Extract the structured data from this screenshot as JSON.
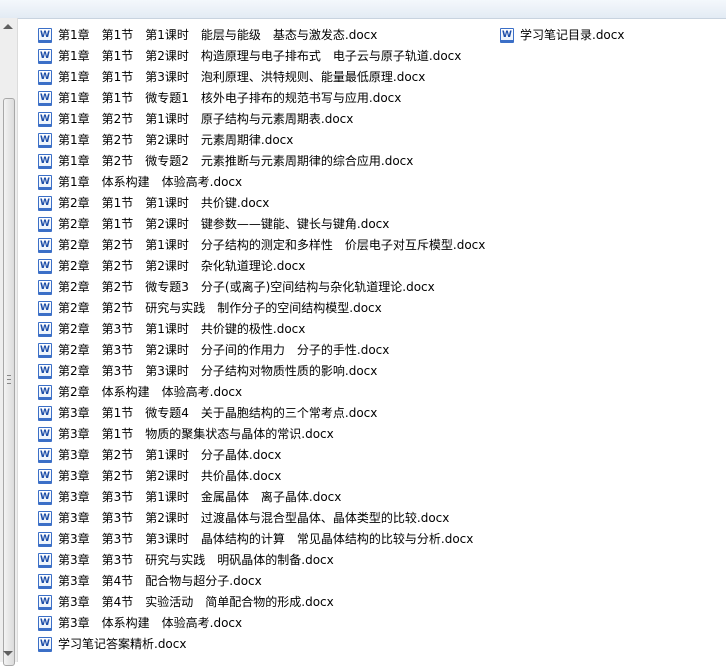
{
  "files": [
    "第1章　第1节　第1课时　能层与能级　基态与激发态.docx",
    "第1章　第1节　第2课时　构造原理与电子排布式　电子云与原子轨道.docx",
    "第1章　第1节　第3课时　泡利原理、洪特规则、能量最低原理.docx",
    "第1章　第1节　微专题1　核外电子排布的规范书写与应用.docx",
    "第1章　第2节　第1课时　原子结构与元素周期表.docx",
    "第1章　第2节　第2课时　元素周期律.docx",
    "第1章　第2节　微专题2　元素推断与元素周期律的综合应用.docx",
    "第1章　体系构建　体验高考.docx",
    "第2章　第1节　第1课时　共价键.docx",
    "第2章　第1节　第2课时　键参数——键能、键长与键角.docx",
    "第2章　第2节　第1课时　分子结构的测定和多样性　价层电子对互斥模型.docx",
    "第2章　第2节　第2课时　杂化轨道理论.docx",
    "第2章　第2节　微专题3　分子(或离子)空间结构与杂化轨道理论.docx",
    "第2章　第2节　研究与实践　制作分子的空间结构模型.docx",
    "第2章　第3节　第1课时　共价键的极性.docx",
    "第2章　第3节　第2课时　分子间的作用力　分子的手性.docx",
    "第2章　第3节　第3课时　分子结构对物质性质的影响.docx",
    "第2章　体系构建　体验高考.docx",
    "第3章　第1节　微专题4　关于晶胞结构的三个常考点.docx",
    "第3章　第1节　物质的聚集状态与晶体的常识.docx",
    "第3章　第2节　第1课时　分子晶体.docx",
    "第3章　第2节　第2课时　共价晶体.docx",
    "第3章　第3节　第1课时　金属晶体　离子晶体.docx",
    "第3章　第3节　第2课时　过渡晶体与混合型晶体、晶体类型的比较.docx",
    "第3章　第3节　第3课时　晶体结构的计算　常见晶体结构的比较与分析.docx",
    "第3章　第3节　研究与实践　明矾晶体的制备.docx",
    "第3章　第4节　配合物与超分子.docx",
    "第3章　第4节　实验活动　简单配合物的形成.docx",
    "第3章　体系构建　体验高考.docx",
    "学习笔记答案精析.docx"
  ],
  "files_col2": [
    "学习笔记目录.docx"
  ],
  "icon": "word-document-icon"
}
